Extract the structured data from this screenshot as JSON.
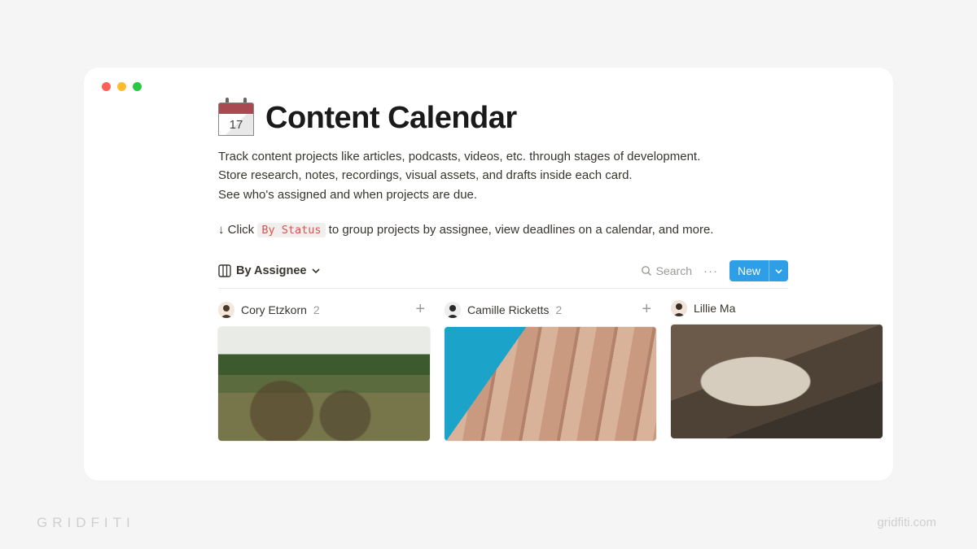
{
  "icon": {
    "type": "calendar",
    "day": "17"
  },
  "title": "Content Calendar",
  "description": {
    "line1": "Track content projects like articles, podcasts, videos, etc. through stages of development.",
    "line2": "Store research, notes, recordings, visual assets, and drafts inside each card.",
    "line3": "See who's assigned and when projects are due."
  },
  "hint": {
    "prefix": "↓ Click ",
    "chip": "By Status",
    "suffix": " to group projects by assignee, view deadlines on a calendar, and more."
  },
  "db": {
    "view_label": "By Assignee",
    "search_label": "Search",
    "new_label": "New"
  },
  "columns": [
    {
      "name": "Cory Etzkorn",
      "count": "2"
    },
    {
      "name": "Camille Ricketts",
      "count": "2"
    },
    {
      "name": "Lillie Ma",
      "count": ""
    }
  ],
  "branding": {
    "left": "GRIDFITI",
    "right": "gridfiti.com"
  }
}
